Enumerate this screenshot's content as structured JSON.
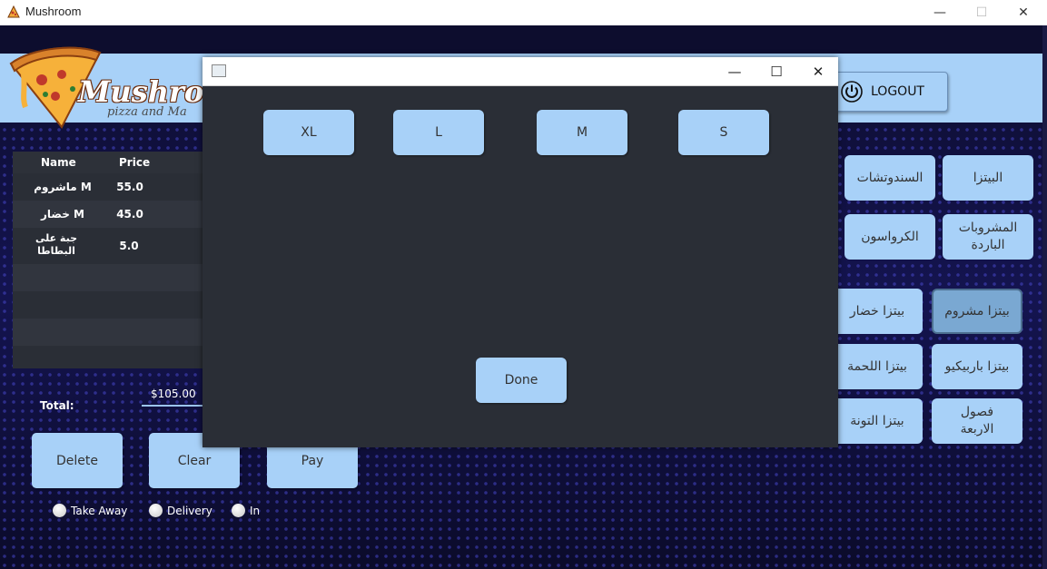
{
  "window": {
    "title": "Mushroom",
    "minimize": "—",
    "maximize": "☐",
    "close": "✕"
  },
  "logo": {
    "brand": "Mushroo",
    "tagline": "pizza and Ma"
  },
  "header": {
    "logout_label": "LOGOUT"
  },
  "order_table": {
    "columns": [
      "Name",
      "Price"
    ],
    "rows": [
      {
        "name": "ماشروم M",
        "price": "55.0"
      },
      {
        "name": "خضار M",
        "price": "45.0"
      },
      {
        "name": "جبة على البطاطا",
        "price": "5.0"
      }
    ]
  },
  "totals": {
    "label": "Total:",
    "value": "$105.00"
  },
  "actions": {
    "delete": "Delete",
    "clear": "Clear",
    "pay": "Pay"
  },
  "order_type": {
    "options": [
      "Take Away",
      "Delivery",
      "In"
    ]
  },
  "categories": {
    "pizza": "البيتزا",
    "sandwiches": "السندوتشات",
    "cold_drinks": "المشروبات الباردة",
    "croissant": "الكرواسون"
  },
  "products": {
    "mushroom": "بيتزا مشروم",
    "vegetables": "بيتزا خضار",
    "bbq": "بيتزا باربيكيو",
    "meat": "بيتزا اللحمة",
    "four_seasons": "فصول الاربعة",
    "tuna": "بيتزا التونة"
  },
  "modal": {
    "sizes": [
      "XL",
      "L",
      "M",
      "S"
    ],
    "done": "Done",
    "minimize": "—",
    "maximize": "☐",
    "close": "✕"
  },
  "colors": {
    "button_blue": "#a8d1f8",
    "panel_dark": "#2a2e36",
    "background": "#0b0b2a"
  }
}
